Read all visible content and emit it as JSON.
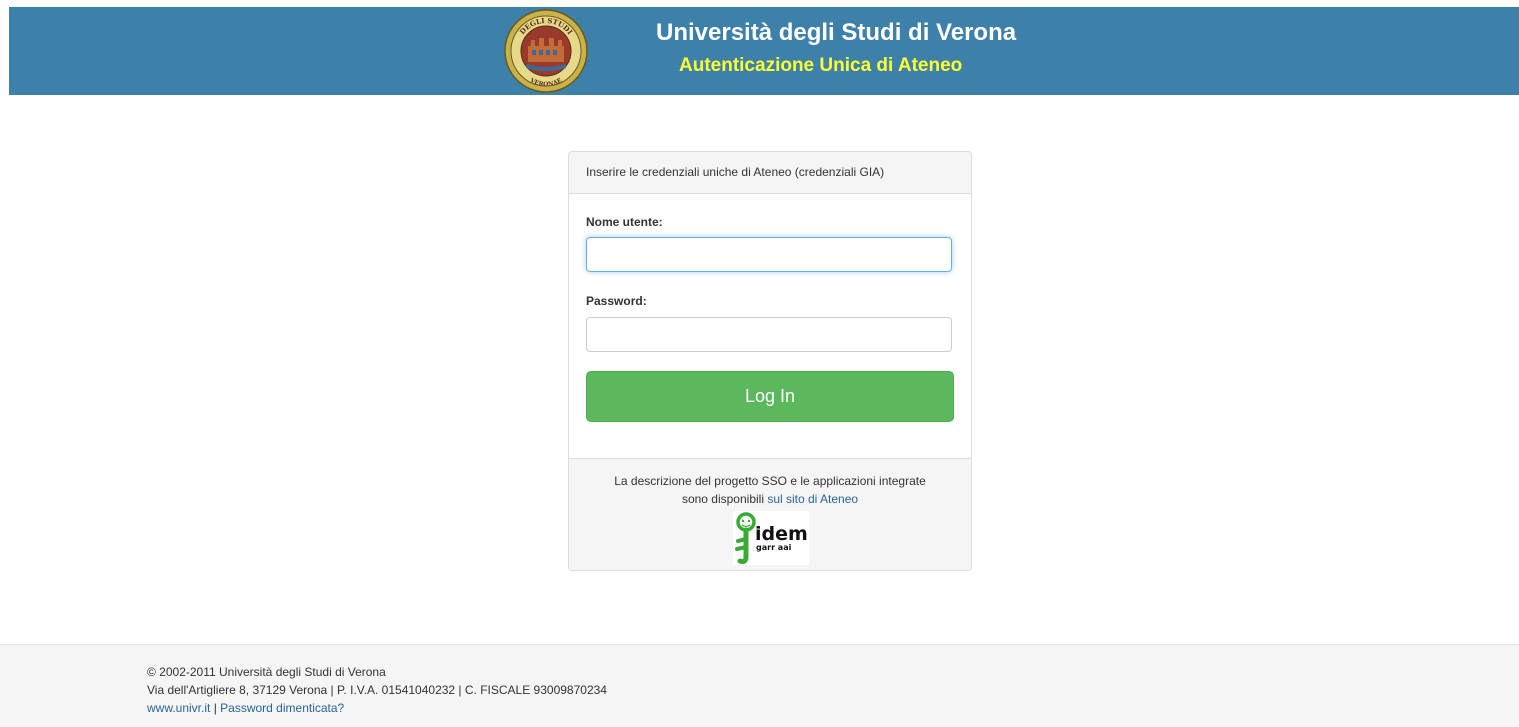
{
  "header": {
    "title": "Università degli Studi di Verona",
    "subtitle": "Autenticazione Unica di Ateneo",
    "seal_text": "UNIVERSITAS VERONAE DEGLI STUDI"
  },
  "login_panel": {
    "heading": "Inserire le credenziali uniche di Ateneo (credenziali GIA)",
    "username_label": "Nome utente:",
    "username_value": "",
    "password_label": "Password:",
    "password_value": "",
    "login_button": "Log In",
    "footer_line1": "La descrizione del progetto SSO e le applicazioni integrate",
    "footer_line2_prefix": "sono disponibili ",
    "footer_link": "sul sito di Ateneo",
    "idem_logo_text": "idem garr aai"
  },
  "page_footer": {
    "copyright": "© 2002-2011 Università degli Studi di Verona",
    "address": "Via dell'Artigliere 8, 37129 Verona | P. I.V.A. 01541040232 | C. FISCALE 93009870234",
    "link_site": "www.univr.it",
    "separator": " | ",
    "link_password": "Password dimenticata?"
  },
  "colors": {
    "header_bg": "#3d80aa",
    "subtitle": "#ffff33",
    "button": "#5cb85c",
    "link": "#2a6496"
  }
}
